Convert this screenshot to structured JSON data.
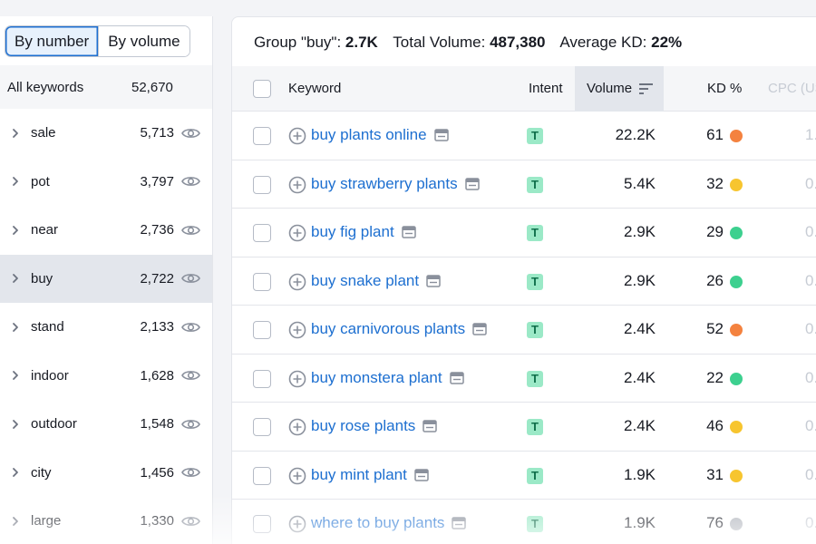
{
  "view_toggle": {
    "by_number": "By number",
    "by_volume": "By volume"
  },
  "groups_panel": {
    "all_label": "All keywords",
    "all_count": "52,670",
    "groups": [
      {
        "name": "sale",
        "count": "5,713"
      },
      {
        "name": "pot",
        "count": "3,797"
      },
      {
        "name": "near",
        "count": "2,736"
      },
      {
        "name": "buy",
        "count": "2,722",
        "selected": true
      },
      {
        "name": "stand",
        "count": "2,133"
      },
      {
        "name": "indoor",
        "count": "1,628"
      },
      {
        "name": "outdoor",
        "count": "1,548"
      },
      {
        "name": "city",
        "count": "1,456"
      },
      {
        "name": "large",
        "count": "1,330"
      }
    ]
  },
  "summary": {
    "group_label": "Group \"buy\":",
    "group_value": "2.7K",
    "volume_label": "Total Volume:",
    "volume_value": "487,380",
    "kd_label": "Average KD:",
    "kd_value": "22%"
  },
  "table": {
    "headers": {
      "keyword": "Keyword",
      "intent": "Intent",
      "volume": "Volume",
      "kd": "KD %",
      "cpc": "CPC (US"
    },
    "rows": [
      {
        "keyword": "buy plants online",
        "intent": "T",
        "volume": "22.2K",
        "kd": "61",
        "kd_color": "#f4823f",
        "cpc": "1."
      },
      {
        "keyword": "buy strawberry plants",
        "intent": "T",
        "volume": "5.4K",
        "kd": "32",
        "kd_color": "#f7c52f",
        "cpc": "0."
      },
      {
        "keyword": "buy fig plant",
        "intent": "T",
        "volume": "2.9K",
        "kd": "29",
        "kd_color": "#3dd08f",
        "cpc": "0."
      },
      {
        "keyword": "buy snake plant",
        "intent": "T",
        "volume": "2.9K",
        "kd": "26",
        "kd_color": "#3dd08f",
        "cpc": "0."
      },
      {
        "keyword": "buy carnivorous plants",
        "intent": "T",
        "volume": "2.4K",
        "kd": "52",
        "kd_color": "#f4823f",
        "cpc": "0."
      },
      {
        "keyword": "buy monstera plant",
        "intent": "T",
        "volume": "2.4K",
        "kd": "22",
        "kd_color": "#3dd08f",
        "cpc": "0."
      },
      {
        "keyword": "buy rose plants",
        "intent": "T",
        "volume": "2.4K",
        "kd": "46",
        "kd_color": "#f7c52f",
        "cpc": "0."
      },
      {
        "keyword": "buy mint plant",
        "intent": "T",
        "volume": "1.9K",
        "kd": "31",
        "kd_color": "#f7c52f",
        "cpc": "0."
      },
      {
        "keyword": "where to buy plants",
        "intent": "T",
        "volume": "1.9K",
        "kd": "76",
        "kd_color": "#b0b4bc",
        "cpc": "0."
      }
    ]
  }
}
